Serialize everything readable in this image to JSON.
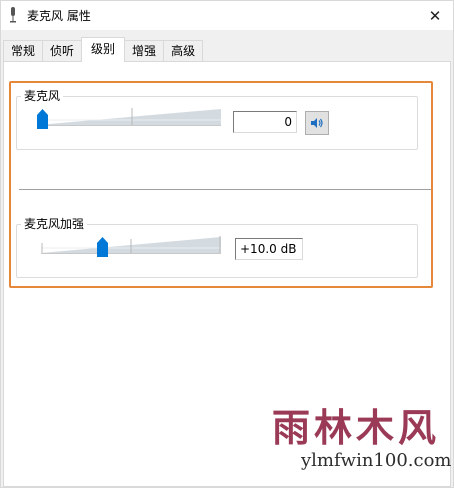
{
  "window": {
    "title": "麦克风 属性",
    "close_symbol": "✕",
    "title_icon": "microphone-icon"
  },
  "tabs": [
    {
      "label": "常规",
      "active": false
    },
    {
      "label": "侦听",
      "active": false
    },
    {
      "label": "级别",
      "active": true
    },
    {
      "label": "增强",
      "active": false
    },
    {
      "label": "高级",
      "active": false
    }
  ],
  "levels": {
    "microphone": {
      "label": "麦克风",
      "value_text": "0",
      "level_fraction": 0.0,
      "speaker_icon": "speaker-icon"
    },
    "boost": {
      "label": "麦克风加强",
      "value_text": "+10.0 dB",
      "level_fraction": 0.333
    }
  },
  "watermark": {
    "cn": "雨林木风",
    "en": "ylmfwin100.com"
  },
  "colors": {
    "highlight": "#e6883a",
    "thumb": "#0078d7",
    "ramp": "#d4dbe0"
  }
}
